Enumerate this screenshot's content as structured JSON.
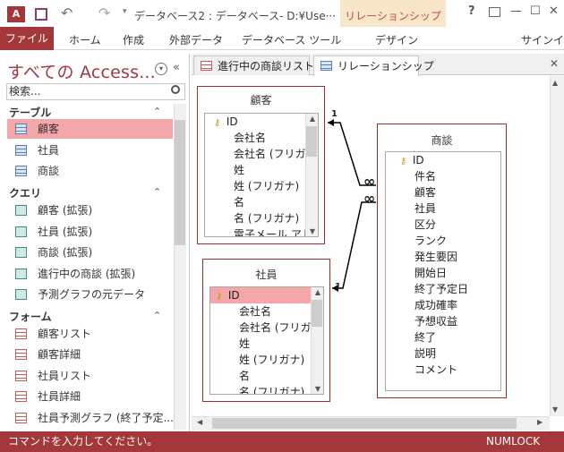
{
  "window": {
    "title": "データベース2 : データベース- D:¥Use···",
    "help": "?",
    "minimize": "—",
    "restore": "☐",
    "close": "✕",
    "undo": "↶",
    "redo": "↷"
  },
  "ribbon": {
    "contextual_label": "リレーションシップ ツール",
    "tabs": [
      "ファイル",
      "ホーム",
      "作成",
      "外部データ",
      "データベース ツール",
      "デザイン"
    ],
    "signin": "サインイン"
  },
  "nav": {
    "title": "すべての Access...",
    "search_placeholder": "検索...",
    "sections": [
      {
        "label": "テーブル",
        "items": [
          "顧客",
          "社員",
          "商談"
        ]
      },
      {
        "label": "クエリ",
        "items": [
          "顧客 (拡張)",
          "社員 (拡張)",
          "商談 (拡張)",
          "進行中の商談 (拡張)",
          "予測グラフの元データ"
        ]
      },
      {
        "label": "フォーム",
        "items": [
          "顧客リスト",
          "顧客詳細",
          "社員リスト",
          "社員詳細",
          "社員予測グラフ (終了予定..."
        ]
      }
    ]
  },
  "doc_tabs": [
    "進行中の商談リスト",
    "リレーションシップ"
  ],
  "tables": {
    "customer": {
      "title": "顧客",
      "fields": [
        "ID",
        "会社名",
        "会社名 (フリガナ",
        "姓",
        "姓 (フリガナ)",
        "名",
        "名 (フリガナ)",
        "電子メール アドレ"
      ]
    },
    "employee": {
      "title": "社員",
      "fields": [
        "ID",
        "会社名",
        "会社名 (フリガナ",
        "姓",
        "姓 (フリガナ)",
        "名",
        "名 (フリガナ)"
      ]
    },
    "deal": {
      "title": "商談",
      "fields": [
        "ID",
        "件名",
        "顧客",
        "社員",
        "区分",
        "ランク",
        "発生要因",
        "開始日",
        "終了予定日",
        "成功確率",
        "予想収益",
        "終了",
        "説明",
        "コメント"
      ]
    }
  },
  "relationships": {
    "one": "1",
    "many": "∞"
  },
  "status": {
    "message": "コマンドを入力してください。",
    "indicator": "NUMLOCK"
  },
  "colors": {
    "accent": "#a4373a",
    "selection": "#f4a6a8",
    "contextual": "#c0504d"
  }
}
